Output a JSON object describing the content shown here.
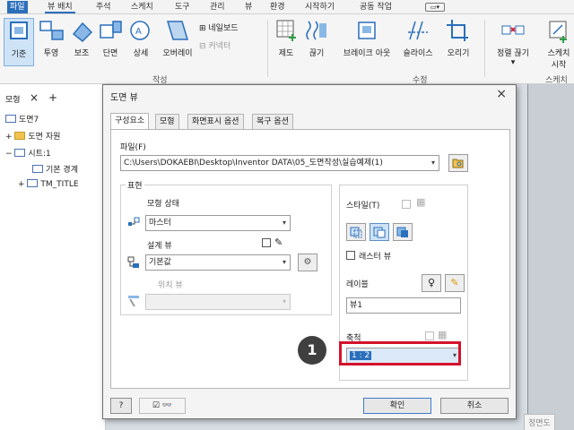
{
  "ribbon_tabs": [
    "파일",
    "뷰 배치",
    "주석",
    "스케치",
    "도구",
    "관리",
    "뷰",
    "환경",
    "시작하기",
    "공동 작업"
  ],
  "ribbon": {
    "buttons": [
      "기준",
      "투영",
      "보조",
      "단면",
      "상세",
      "오버레이",
      "제도",
      "끊기",
      "브레이크 아웃",
      "슬라이스",
      "오리기",
      "정렬 끊기",
      "스케치"
    ],
    "small": [
      "네일보드",
      "커넥터"
    ],
    "sketch_sub": "시작",
    "groups": [
      "작성",
      "수정",
      "스케치"
    ]
  },
  "browser": {
    "tab": "모형",
    "close": "×",
    "add": "+",
    "tree": [
      "도면7",
      "도면 자원",
      "시트:1",
      "기본 경계",
      "TM_TITLE"
    ]
  },
  "canvas": {
    "view_label": "정면도"
  },
  "dialog": {
    "title": "도면 뷰",
    "close": "×",
    "tabs": [
      "구성요소",
      "모형",
      "화면표시 옵션",
      "복구 옵션"
    ],
    "file_label": "파일(F)",
    "file_path": "C:\\Users\\DOKAEBI\\Desktop\\Inventor DATA\\05_도면작성\\실습예제(1)",
    "represent_label": "표현",
    "model_state_label": "모형 상태",
    "model_state_value": "마스터",
    "design_view_label": "설계 뷰",
    "design_view_value": "기본값",
    "position_view_label": "위치 뷰",
    "style_label": "스타일(T)",
    "raster_label": "래스터 뷰",
    "label_label": "레이블",
    "label_value": "뷰1",
    "scale_label": "축척",
    "scale_value": "1 : 2",
    "ok": "확인",
    "cancel": "취소",
    "help": "?"
  },
  "callout": "1",
  "colors": {
    "accent": "#2a6fbb",
    "highlight": "#d4122b"
  }
}
